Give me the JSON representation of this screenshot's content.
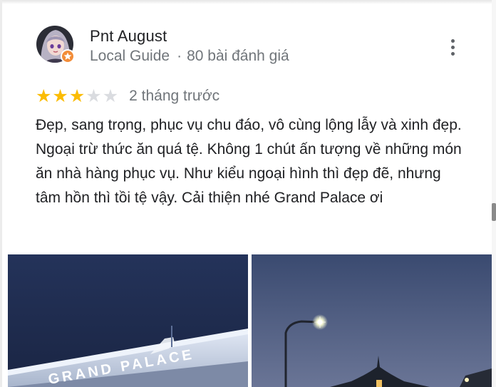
{
  "review": {
    "author_name": "Pnt August",
    "badge": "Local Guide",
    "separator": "·",
    "review_count": "80 bài đánh giá",
    "rating": 3,
    "rating_max": 5,
    "date": "2 tháng trước",
    "text": "Đẹp, sang trọng, phục vụ chu đáo, vô cùng lộng lẫy và xinh đẹp. Ngoại trừ thức ăn quá tệ. Không 1 chút ấn tượng về những món ăn nhà hàng phục vụ. Như kiểu ngoại hình thì đẹp đẽ, nhưng tâm hồn thì tồi tệ vậy. Cải thiện nhé Grand Palace ơi"
  },
  "photos": [
    {
      "caption": "GRAND PALACE"
    },
    {
      "caption": ""
    }
  ],
  "icons": {
    "more": "more-vert-icon",
    "star_filled": "star-icon",
    "star_empty": "star-outline-icon",
    "local_guide_badge": "local-guide-badge-icon"
  },
  "colors": {
    "star_filled": "#fbbc04",
    "star_empty": "#dadce0",
    "secondary_text": "#70757a",
    "badge": "#f28c38",
    "sky": "#1f2c4d"
  }
}
